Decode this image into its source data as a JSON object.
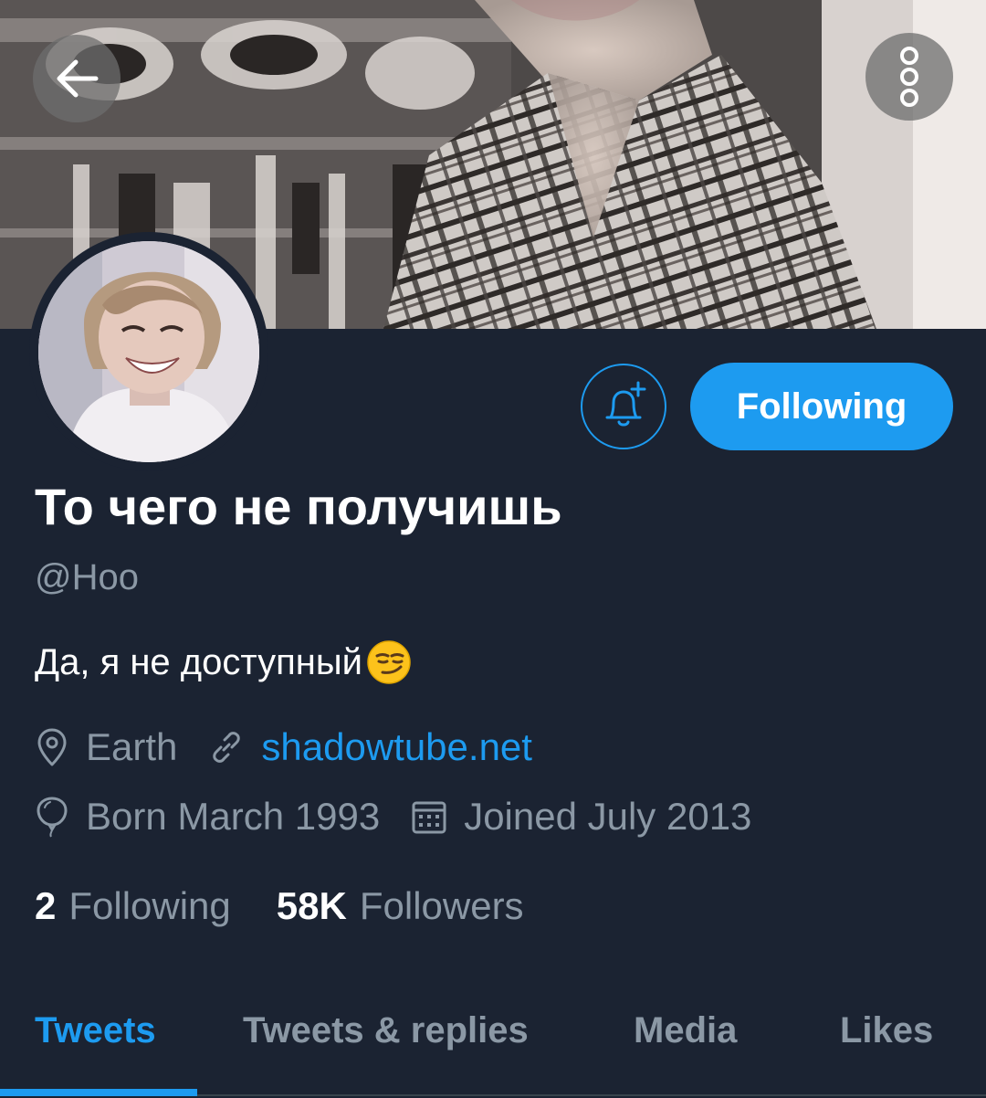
{
  "profile": {
    "display_name": "То чего не получишь",
    "handle": "@Hoo",
    "bio": "Да, я не доступный",
    "bio_emoji": "smirking-face-emoji",
    "location": "Earth",
    "website": "shadowtube.net",
    "birthday": "Born March 1993",
    "joined": "Joined July 2013"
  },
  "stats": {
    "following_count": "2",
    "following_label": "Following",
    "followers_count": "58K",
    "followers_label": "Followers"
  },
  "actions": {
    "follow_button_label": "Following",
    "back_icon": "arrow-left-icon",
    "more_icon": "more-vertical-icon",
    "notify_icon": "bell-plus-icon"
  },
  "tabs": [
    {
      "label": "Tweets",
      "active": true
    },
    {
      "label": "Tweets & replies",
      "active": false
    },
    {
      "label": "Media",
      "active": false
    },
    {
      "label": "Likes",
      "active": false
    }
  ],
  "colors": {
    "background": "#1b2332",
    "accent": "#1d9bf0",
    "secondary_text": "#8b98a5",
    "primary_text": "#ffffff"
  }
}
